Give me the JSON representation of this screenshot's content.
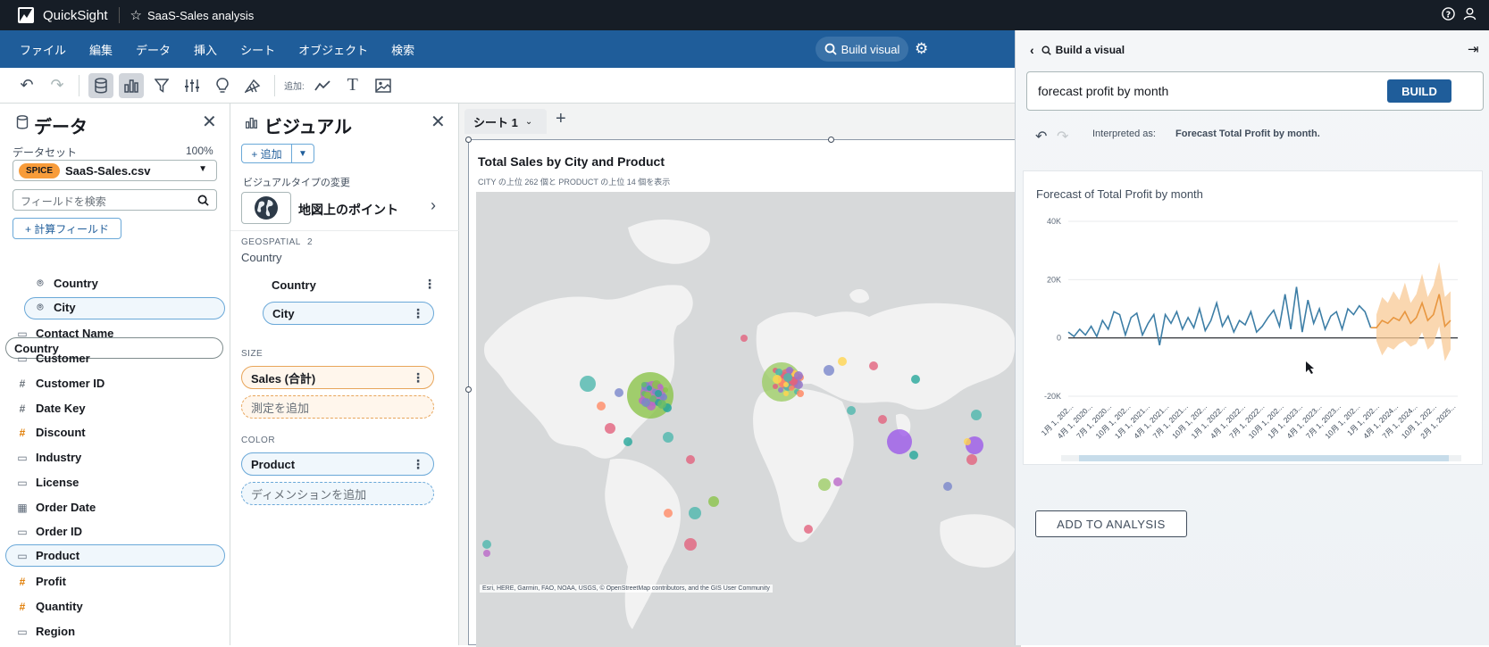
{
  "app": {
    "name": "QuickSight",
    "analysis_name": "SaaS-Sales analysis"
  },
  "menu": [
    "ファイル",
    "編集",
    "データ",
    "挿入",
    "シート",
    "オブジェクト",
    "検索"
  ],
  "build_visual_button": "Build visual",
  "toolbar": {
    "add_label": "追加:"
  },
  "data_panel": {
    "title": "データ",
    "dataset_label": "データセット",
    "dataset_percent": "100%",
    "spice_badge": "SPICE",
    "dataset_name": "SaaS-Sales.csv",
    "search_placeholder": "フィールドを検索",
    "calc_field_button": "+ 計算フィールド",
    "hierarchy": {
      "name": "Country",
      "children": [
        "Country",
        "City"
      ]
    },
    "fields": [
      {
        "name": "Contact Name",
        "icon": "dimension-icon"
      },
      {
        "name": "Customer",
        "icon": "dimension-icon"
      },
      {
        "name": "Customer ID",
        "icon": "number-icon"
      },
      {
        "name": "Date Key",
        "icon": "number-icon"
      },
      {
        "name": "Discount",
        "icon": "measure-icon"
      },
      {
        "name": "Industry",
        "icon": "dimension-icon"
      },
      {
        "name": "License",
        "icon": "dimension-icon"
      },
      {
        "name": "Order Date",
        "icon": "calendar-icon"
      },
      {
        "name": "Order ID",
        "icon": "dimension-icon"
      },
      {
        "name": "Product",
        "icon": "dimension-icon"
      },
      {
        "name": "Profit",
        "icon": "measure-icon"
      },
      {
        "name": "Quantity",
        "icon": "measure-icon"
      },
      {
        "name": "Region",
        "icon": "dimension-icon"
      }
    ]
  },
  "visual_panel": {
    "title": "ビジュアル",
    "add_button": "+ 追加",
    "change_type_label": "ビジュアルタイプの変更",
    "visual_type": "地図上のポイント",
    "geospatial_label": "GEOSPATIAL",
    "geospatial_count": "2",
    "geo_group": "Country",
    "geo_fields": [
      "Country",
      "City"
    ],
    "size_label": "SIZE",
    "size_field": "Sales (合計)",
    "size_add": "測定を追加",
    "color_label": "COLOR",
    "color_field": "Product",
    "color_add": "ディメンションを追加"
  },
  "sheet": {
    "tab": "シート 1"
  },
  "visual": {
    "title": "Total Sales by City and Product",
    "subtitle": "CITY の上位 262 個と PRODUCT の上位 14 個を表示",
    "attribution": "Esri, HERE, Garmin, FAO, NOAA, USGS, © OpenStreetMap contributors, and the GIS User Community"
  },
  "build_panel": {
    "back_label": "Build a visual",
    "query": "forecast profit by month",
    "build_button": "BUILD",
    "interpreted_prefix": "Interpreted as:",
    "interpreted_value": "Forecast Total Profit by month.",
    "add_button": "ADD TO ANALYSIS"
  },
  "chart_data": {
    "type": "line",
    "title": "Forecast of Total Profit by month",
    "y_ticks": [
      "40K",
      "20K",
      "0",
      "-20K"
    ],
    "ylim": [
      -20000,
      40000
    ],
    "x_tick_labels": [
      "1月 1, 202...",
      "4月 1, 2020...",
      "7月 1, 2020...",
      "10月 1, 202...",
      "1月 1, 2021...",
      "4月 1, 2021...",
      "7月 1, 2021...",
      "10月 1, 202...",
      "1月 1, 2022...",
      "4月 1, 2022...",
      "7月 1, 2022...",
      "10月 1, 202...",
      "1月 1, 2023...",
      "4月 1, 2023...",
      "7月 1, 2023...",
      "10月 1, 202...",
      "1月 1, 202...",
      "4月 1, 2024...",
      "7月 1, 2024...",
      "10月 1, 202...",
      "2月 1, 2025..."
    ],
    "actual": [
      2000,
      500,
      3000,
      1000,
      4000,
      500,
      6000,
      3000,
      9000,
      8000,
      1000,
      7000,
      8500,
      1000,
      5000,
      8000,
      -2500,
      8000,
      5000,
      9000,
      3000,
      7000,
      3500,
      10000,
      2500,
      6000,
      12000,
      4000,
      7500,
      2000,
      6000,
      4500,
      9000,
      2000,
      4000,
      7000,
      9500,
      4000,
      15000,
      3000,
      17500,
      2000,
      13000,
      5000,
      10000,
      3000,
      7500,
      9000,
      3000,
      10000,
      8000,
      11000,
      9000,
      3500
    ],
    "forecast": [
      3500,
      6000,
      5000,
      7000,
      6000,
      9000,
      5000,
      7000,
      12000,
      6000,
      8000,
      15000,
      4000,
      6000
    ],
    "forecast_upper": [
      8000,
      14000,
      12000,
      16000,
      13000,
      19000,
      12000,
      15000,
      22000,
      14000,
      18000,
      26000,
      14000,
      16000
    ],
    "forecast_lower": [
      -1000,
      -6000,
      -3000,
      -4000,
      -2000,
      -1000,
      -3000,
      -2000,
      2000,
      -4000,
      -2000,
      4000,
      -8000,
      -4000
    ],
    "colors": {
      "actual": "#3d7ea6",
      "forecast": "#f0a85a",
      "band": "#f8c995"
    }
  }
}
